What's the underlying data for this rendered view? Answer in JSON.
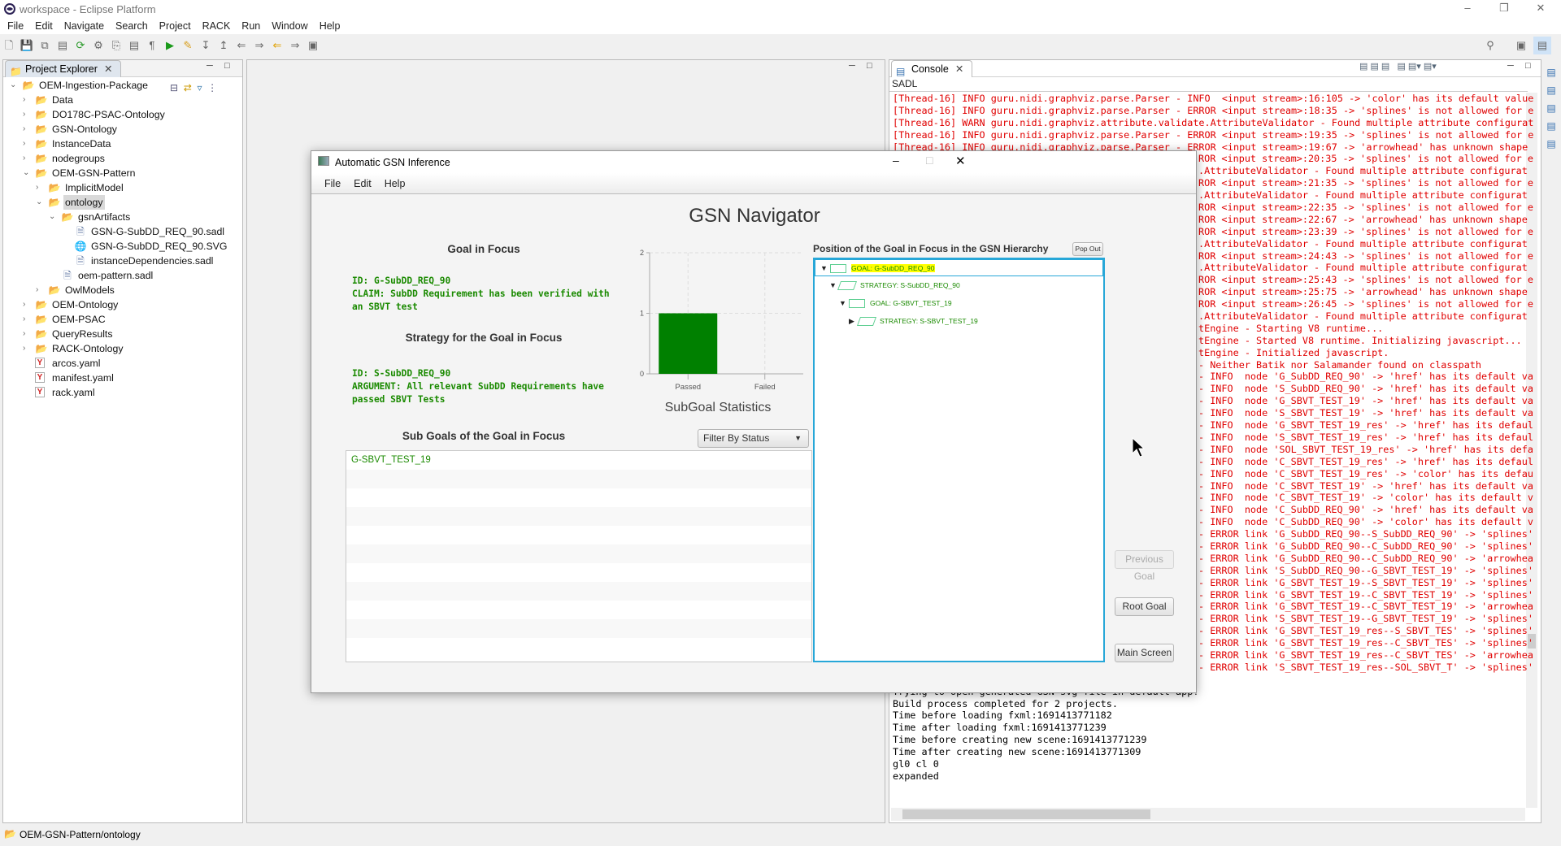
{
  "window": {
    "title": "workspace - Eclipse Platform",
    "controls": [
      "minimize",
      "restore",
      "close"
    ]
  },
  "menu": [
    "File",
    "Edit",
    "Navigate",
    "Search",
    "Project",
    "RACK",
    "Run",
    "Window",
    "Help"
  ],
  "toolbar": [
    "new-icon",
    "save-icon",
    "save-all-icon",
    "binary-icon",
    "refresh-icon",
    "settings-icon",
    "copy-icon",
    "page-icon",
    "pilcrow-icon",
    "run-icon",
    "pen-icon",
    "next-annotation-icon",
    "prev-annotation-icon",
    "back-edit-icon",
    "forward-edit-icon",
    "back-icon",
    "forward-icon",
    "pin-icon"
  ],
  "explorer": {
    "tab": "Project Explorer",
    "items": [
      {
        "label": "OEM-Ingestion-Package",
        "level": 0,
        "type": "project",
        "state": "expanded"
      },
      {
        "label": "Data",
        "level": 1,
        "type": "folder",
        "state": "collapsed"
      },
      {
        "label": "DO178C-PSAC-Ontology",
        "level": 1,
        "type": "project",
        "state": "collapsed"
      },
      {
        "label": "GSN-Ontology",
        "level": 1,
        "type": "project",
        "state": "collapsed"
      },
      {
        "label": "InstanceData",
        "level": 1,
        "type": "folder",
        "state": "collapsed"
      },
      {
        "label": "nodegroups",
        "level": 1,
        "type": "folder",
        "state": "collapsed"
      },
      {
        "label": "OEM-GSN-Pattern",
        "level": 1,
        "type": "project",
        "state": "expanded"
      },
      {
        "label": "ImplicitModel",
        "level": 2,
        "type": "folder",
        "state": "collapsed"
      },
      {
        "label": "ontology",
        "level": 2,
        "type": "folder",
        "state": "expanded",
        "selected": true
      },
      {
        "label": "gsnArtifacts",
        "level": 3,
        "type": "folder",
        "state": "expanded"
      },
      {
        "label": "GSN-G-SubDD_REQ_90.sadl",
        "level": 4,
        "type": "file"
      },
      {
        "label": "GSN-G-SubDD_REQ_90.SVG",
        "level": 4,
        "type": "globe"
      },
      {
        "label": "instanceDependencies.sadl",
        "level": 4,
        "type": "file"
      },
      {
        "label": "oem-pattern.sadl",
        "level": 3,
        "type": "file"
      },
      {
        "label": "OwlModels",
        "level": 2,
        "type": "folder",
        "state": "collapsed"
      },
      {
        "label": "OEM-Ontology",
        "level": 1,
        "type": "project",
        "state": "collapsed"
      },
      {
        "label": "OEM-PSAC",
        "level": 1,
        "type": "project",
        "state": "collapsed"
      },
      {
        "label": "QueryResults",
        "level": 1,
        "type": "folder",
        "state": "collapsed"
      },
      {
        "label": "RACK-Ontology",
        "level": 1,
        "type": "project",
        "state": "collapsed"
      },
      {
        "label": "arcos.yaml",
        "level": 1,
        "type": "yaml"
      },
      {
        "label": "manifest.yaml",
        "level": 1,
        "type": "yaml"
      },
      {
        "label": "rack.yaml",
        "level": 1,
        "type": "yaml"
      }
    ]
  },
  "console": {
    "tab": "Console",
    "name": "SADL",
    "lines": [
      {
        "text": "[Thread-16] INFO guru.nidi.graphviz.parse.Parser - INFO  <input stream>:16:105 -> 'color' has its default value"
      },
      {
        "text": "[Thread-16] INFO guru.nidi.graphviz.parse.Parser - ERROR <input stream>:18:35 -> 'splines' is not allowed for e"
      },
      {
        "text": "[Thread-16] WARN guru.nidi.graphviz.attribute.validate.AttributeValidator - Found multiple attribute configurat"
      },
      {
        "text": "[Thread-16] INFO guru.nidi.graphviz.parse.Parser - ERROR <input stream>:19:35 -> 'splines' is not allowed for e"
      },
      {
        "text": "[Thread-16] INFO guru.nidi.graphviz.parse.Parser - ERROR <input stream>:19:67 -> 'arrowhead' has unknown shape"
      },
      {
        "text": "ROR <input stream>:20:35 -> 'splines' is not allowed for e",
        "partial": true
      },
      {
        "text": ".AttributeValidator - Found multiple attribute configurat",
        "partial": true
      },
      {
        "text": "ROR <input stream>:21:35 -> 'splines' is not allowed for e",
        "partial": true
      },
      {
        "text": ".AttributeValidator - Found multiple attribute configurat",
        "partial": true
      },
      {
        "text": "ROR <input stream>:22:35 -> 'splines' is not allowed for e",
        "partial": true
      },
      {
        "text": "ROR <input stream>:22:67 -> 'arrowhead' has unknown shape",
        "partial": true
      },
      {
        "text": "ROR <input stream>:23:39 -> 'splines' is not allowed for e",
        "partial": true
      },
      {
        "text": ".AttributeValidator - Found multiple attribute configurat",
        "partial": true
      },
      {
        "text": "ROR <input stream>:24:43 -> 'splines' is not allowed for e",
        "partial": true
      },
      {
        "text": ".AttributeValidator - Found multiple attribute configurat",
        "partial": true
      },
      {
        "text": "ROR <input stream>:25:43 -> 'splines' is not allowed for e",
        "partial": true
      },
      {
        "text": "ROR <input stream>:25:75 -> 'arrowhead' has unknown shape",
        "partial": true
      },
      {
        "text": "ROR <input stream>:26:45 -> 'splines' is not allowed for e",
        "partial": true
      },
      {
        "text": ".AttributeValidator - Found multiple attribute configurat",
        "partial": true
      },
      {
        "text": "tEngine - Starting V8 runtime...",
        "partial": true
      },
      {
        "text": "tEngine - Started V8 runtime. Initializing javascript...",
        "partial": true
      },
      {
        "text": "tEngine - Initialized javascript.",
        "partial": true
      },
      {
        "text": "- Neither Batik nor Salamander found on classpath",
        "partial": true
      },
      {
        "text": "- INFO  node 'G_SubDD_REQ_90' -> 'href' has its default va",
        "partial": true
      },
      {
        "text": "- INFO  node 'S_SubDD_REQ_90' -> 'href' has its default va",
        "partial": true
      },
      {
        "text": "- INFO  node 'G_SBVT_TEST_19' -> 'href' has its default va",
        "partial": true
      },
      {
        "text": "- INFO  node 'S_SBVT_TEST_19' -> 'href' has its default va",
        "partial": true
      },
      {
        "text": "- INFO  node 'G_SBVT_TEST_19_res' -> 'href' has its defaul",
        "partial": true
      },
      {
        "text": "- INFO  node 'S_SBVT_TEST_19_res' -> 'href' has its defaul",
        "partial": true
      },
      {
        "text": "- INFO  node 'SOL_SBVT_TEST_19_res' -> 'href' has its defa",
        "partial": true
      },
      {
        "text": "- INFO  node 'C_SBVT_TEST_19_res' -> 'href' has its defaul",
        "partial": true
      },
      {
        "text": "- INFO  node 'C_SBVT_TEST_19_res' -> 'color' has its defau",
        "partial": true
      },
      {
        "text": "- INFO  node 'C_SBVT_TEST_19' -> 'href' has its default va",
        "partial": true
      },
      {
        "text": "- INFO  node 'C_SBVT_TEST_19' -> 'color' has its default v",
        "partial": true
      },
      {
        "text": "- INFO  node 'C_SubDD_REQ_90' -> 'href' has its default va",
        "partial": true
      },
      {
        "text": "- INFO  node 'C_SubDD_REQ_90' -> 'color' has its default v",
        "partial": true
      },
      {
        "text": "- ERROR link 'G_SubDD_REQ_90--S_SubDD_REQ_90' -> 'splines'",
        "partial": true
      },
      {
        "text": "- ERROR link 'G_SubDD_REQ_90--C_SubDD_REQ_90' -> 'splines'",
        "partial": true
      },
      {
        "text": "- ERROR link 'G_SubDD_REQ_90--C_SubDD_REQ_90' -> 'arrowhea",
        "partial": true
      },
      {
        "text": "- ERROR link 'S_SubDD_REQ_90--G_SBVT_TEST_19' -> 'splines'",
        "partial": true
      },
      {
        "text": "- ERROR link 'G_SBVT_TEST_19--S_SBVT_TEST_19' -> 'splines'",
        "partial": true
      },
      {
        "text": "- ERROR link 'G_SBVT_TEST_19--C_SBVT_TEST_19' -> 'splines'",
        "partial": true
      },
      {
        "text": "- ERROR link 'G_SBVT_TEST_19--C_SBVT_TEST_19' -> 'arrowhea",
        "partial": true
      },
      {
        "text": "- ERROR link 'S_SBVT_TEST_19--G_SBVT_TEST_19' -> 'splines'",
        "partial": true
      },
      {
        "text": "- ERROR link 'G_SBVT_TEST_19_res--S_SBVT_TES' -> 'splines'",
        "partial": true
      },
      {
        "text": "- ERROR link 'G_SBVT_TEST_19_res--C_SBVT_TES' -> 'splines'",
        "partial": true
      },
      {
        "text": "- ERROR link 'G_SBVT_TEST_19_res--C_SBVT_TES' -> 'arrowhea",
        "partial": true
      },
      {
        "text": "- ERROR link 'S_SBVT_TEST_19_res--SOL_SBVT_T' -> 'splines'",
        "partial": true
      },
      {
        "text": "",
        "partial": true
      },
      {
        "text": "Trying to open generated GSN svg file in default app!",
        "black": true
      },
      {
        "text": "Build process completed for 2 projects.",
        "black": true
      },
      {
        "text": "Time before loading fxml:1691413771182",
        "black": true
      },
      {
        "text": "Time after loading fxml:1691413771239",
        "black": true
      },
      {
        "text": "Time before creating new scene:1691413771239",
        "black": true
      },
      {
        "text": "Time after creating new scene:1691413771309",
        "black": true
      },
      {
        "text": "gl0 cl 0",
        "black": true
      },
      {
        "text": "expanded",
        "black": true
      }
    ]
  },
  "status_bar": {
    "path": "OEM-GSN-Pattern/ontology"
  },
  "dialog": {
    "title": "Automatic GSN Inference",
    "menu": [
      "File",
      "Edit",
      "Help"
    ],
    "heading": "GSN Navigator",
    "goal_section": {
      "title": "Goal in Focus",
      "id": "ID: G-SubDD_REQ_90",
      "claim": "CLAIM: SubDD Requirement has been verified with\nan SBVT test"
    },
    "strategy_section": {
      "title": "Strategy for the Goal in Focus",
      "id": "ID: S-SubDD_REQ_90",
      "argument": "ARGUMENT: All relevant SubDD Requirements have\npassed SBVT Tests"
    },
    "subgoals": {
      "title": "Sub Goals of the Goal in Focus",
      "filter": "Filter By Status",
      "items": [
        "G-SBVT_TEST_19"
      ]
    },
    "hierarchy": {
      "title": "Position of the Goal in Focus in the GSN Hierarchy",
      "pop_out": "Pop Out",
      "nodes": [
        {
          "label": "GOAL: G-SubDD_REQ_90",
          "kind": "goal",
          "level": 0,
          "state": "expanded",
          "highlighted": true
        },
        {
          "label": "STRATEGY: S-SubDD_REQ_90",
          "kind": "strategy",
          "level": 1,
          "state": "expanded"
        },
        {
          "label": "GOAL: G-SBVT_TEST_19",
          "kind": "goal",
          "level": 2,
          "state": "expanded"
        },
        {
          "label": "STRATEGY: S-SBVT_TEST_19",
          "kind": "strategy",
          "level": 3,
          "state": "collapsed"
        }
      ]
    },
    "buttons": {
      "previous": "Previous Goal",
      "root": "Root Goal",
      "main": "Main Screen"
    }
  },
  "chart_data": {
    "type": "bar",
    "title": "SubGoal Statistics",
    "categories": [
      "Passed",
      "Failed"
    ],
    "values": [
      1,
      0
    ],
    "ylim": [
      0,
      2
    ],
    "yticks": [
      0,
      1,
      2
    ],
    "grid": true,
    "color": "#008000"
  }
}
